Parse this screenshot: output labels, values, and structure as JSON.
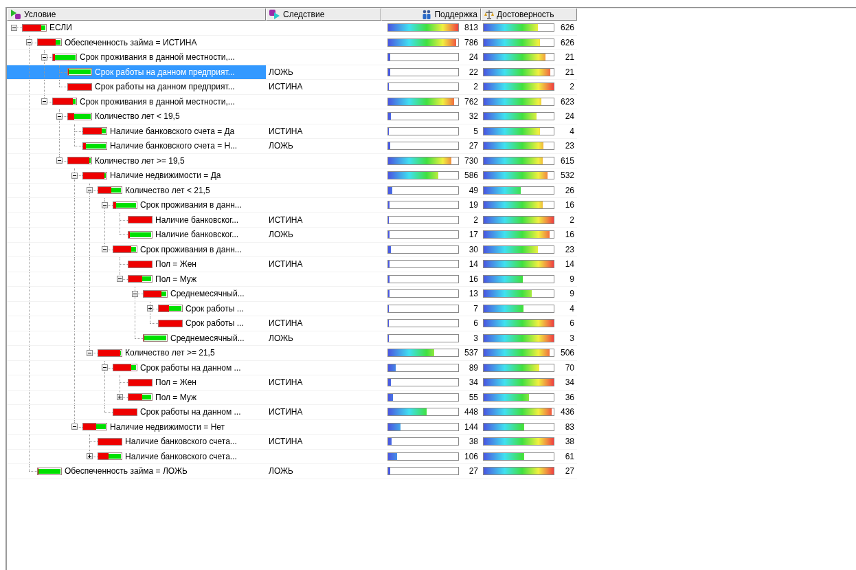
{
  "columns": [
    {
      "label": "Условие"
    },
    {
      "label": "Следствие"
    },
    {
      "label": "Поддержка"
    },
    {
      "label": "Достоверность"
    }
  ],
  "tree": {
    "nodes": [
      {
        "label": "ЕСЛИ",
        "split": {
          "level": 0.8
        },
        "support": {
          "value": "813",
          "level": 1
        },
        "confidence": {
          "value": "626",
          "level": 0.77
        },
        "expanded": true,
        "selected": false,
        "children": [
          {
            "label": "Обеспеченность займа = ИСТИНА",
            "split": {
              "level": 0.75
            },
            "support": {
              "value": "786",
              "level": 0.97
            },
            "confidence": {
              "value": "626",
              "level": 0.8
            },
            "expanded": true,
            "selected": false,
            "children": [
              {
                "label": "Срок проживания в данной местности,...",
                "split": {
                  "level": 0.1
                },
                "support": {
                  "value": "24",
                  "level": 0.03
                },
                "confidence": {
                  "value": "21",
                  "level": 0.88
                },
                "expanded": true,
                "selected": false,
                "children": [
                  {
                    "label": "Срок работы на данном предприят...",
                    "result": "ЛОЖЬ",
                    "split": {
                      "level": 0.03
                    },
                    "support": {
                      "value": "22",
                      "level": 0.03
                    },
                    "confidence": {
                      "value": "21",
                      "level": 0.95
                    },
                    "selected": true
                  },
                  {
                    "label": "Срок работы на данном предприят...",
                    "result": "ИСТИНА",
                    "split": {
                      "level": 1
                    },
                    "support": {
                      "value": "2",
                      "level": 0
                    },
                    "confidence": {
                      "value": "2",
                      "level": 1
                    },
                    "selected": false
                  }
                ]
              },
              {
                "label": "Срок проживания в данной местности,...",
                "split": {
                  "level": 0.85
                },
                "support": {
                  "value": "762",
                  "level": 0.94
                },
                "confidence": {
                  "value": "623",
                  "level": 0.82
                },
                "expanded": true,
                "selected": false,
                "children": [
                  {
                    "label": "Количество лет < 19,5",
                    "split": {
                      "level": 0.25
                    },
                    "support": {
                      "value": "32",
                      "level": 0.04
                    },
                    "confidence": {
                      "value": "24",
                      "level": 0.75
                    },
                    "expanded": true,
                    "selected": false,
                    "children": [
                      {
                        "label": "Наличие банковского счета = Да",
                        "result": "ИСТИНА",
                        "split": {
                          "level": 0.8
                        },
                        "support": {
                          "value": "5",
                          "level": 0.01
                        },
                        "confidence": {
                          "value": "4",
                          "level": 0.8
                        },
                        "selected": false
                      },
                      {
                        "label": "Наличие банковского счета = Н...",
                        "result": "ЛОЖЬ",
                        "split": {
                          "level": 0.12
                        },
                        "support": {
                          "value": "27",
                          "level": 0.03
                        },
                        "confidence": {
                          "value": "23",
                          "level": 0.85
                        },
                        "selected": false
                      }
                    ]
                  },
                  {
                    "label": "Количество лет >= 19,5",
                    "split": {
                      "level": 0.9
                    },
                    "support": {
                      "value": "730",
                      "level": 0.9
                    },
                    "confidence": {
                      "value": "615",
                      "level": 0.84
                    },
                    "expanded": true,
                    "selected": false,
                    "children": [
                      {
                        "label": "Наличие недвижимости = Да",
                        "split": {
                          "level": 0.92
                        },
                        "support": {
                          "value": "586",
                          "level": 0.72
                        },
                        "confidence": {
                          "value": "532",
                          "level": 0.91
                        },
                        "expanded": true,
                        "selected": false,
                        "children": [
                          {
                            "label": "Количество лет < 21,5",
                            "split": {
                              "level": 0.55
                            },
                            "support": {
                              "value": "49",
                              "level": 0.06
                            },
                            "confidence": {
                              "value": "26",
                              "level": 0.53
                            },
                            "expanded": true,
                            "selected": false,
                            "children": [
                              {
                                "label": "Срок проживания в данн...",
                                "split": {
                                  "level": 0.12
                                },
                                "support": {
                                  "value": "19",
                                  "level": 0.02
                                },
                                "confidence": {
                                  "value": "16",
                                  "level": 0.84
                                },
                                "expanded": true,
                                "selected": false,
                                "children": [
                                  {
                                    "label": "Наличие банковског...",
                                    "result": "ИСТИНА",
                                    "split": {
                                      "level": 1
                                    },
                                    "support": {
                                      "value": "2",
                                      "level": 0
                                    },
                                    "confidence": {
                                      "value": "2",
                                      "level": 1
                                    },
                                    "selected": false
                                  },
                                  {
                                    "label": "Наличие банковског...",
                                    "result": "ЛОЖЬ",
                                    "split": {
                                      "level": 0.06
                                    },
                                    "support": {
                                      "value": "17",
                                      "level": 0.02
                                    },
                                    "confidence": {
                                      "value": "16",
                                      "level": 0.94
                                    },
                                    "selected": false
                                  }
                                ]
                              },
                              {
                                "label": "Срок проживания в данн...",
                                "split": {
                                  "level": 0.75
                                },
                                "support": {
                                  "value": "30",
                                  "level": 0.04
                                },
                                "confidence": {
                                  "value": "23",
                                  "level": 0.77
                                },
                                "expanded": true,
                                "selected": false,
                                "children": [
                                  {
                                    "label": "Пол = Жен",
                                    "result": "ИСТИНА",
                                    "split": {
                                      "level": 1
                                    },
                                    "support": {
                                      "value": "14",
                                      "level": 0.02
                                    },
                                    "confidence": {
                                      "value": "14",
                                      "level": 1
                                    },
                                    "selected": false
                                  },
                                  {
                                    "label": "Пол = Муж",
                                    "split": {
                                      "level": 0.6
                                    },
                                    "support": {
                                      "value": "16",
                                      "level": 0.02
                                    },
                                    "confidence": {
                                      "value": "9",
                                      "level": 0.56
                                    },
                                    "expanded": true,
                                    "selected": false,
                                    "children": [
                                      {
                                        "label": "Среднемесячный...",
                                        "split": {
                                          "level": 0.75
                                        },
                                        "support": {
                                          "value": "13",
                                          "level": 0.02
                                        },
                                        "confidence": {
                                          "value": "9",
                                          "level": 0.69
                                        },
                                        "expanded": true,
                                        "selected": false,
                                        "children": [
                                          {
                                            "label": "Срок работы ...",
                                            "split": {
                                              "level": 0.45
                                            },
                                            "support": {
                                              "value": "7",
                                              "level": 0.01
                                            },
                                            "confidence": {
                                              "value": "4",
                                              "level": 0.57
                                            },
                                            "expanded": false,
                                            "selected": false
                                          },
                                          {
                                            "label": "Срок работы ...",
                                            "result": "ИСТИНА",
                                            "split": {
                                              "level": 1
                                            },
                                            "support": {
                                              "value": "6",
                                              "level": 0.01
                                            },
                                            "confidence": {
                                              "value": "6",
                                              "level": 1
                                            },
                                            "selected": false
                                          }
                                        ]
                                      },
                                      {
                                        "label": "Среднемесячный...",
                                        "result": "ЛОЖЬ",
                                        "split": {
                                          "level": 0
                                        },
                                        "support": {
                                          "value": "3",
                                          "level": 0
                                        },
                                        "confidence": {
                                          "value": "3",
                                          "level": 1
                                        },
                                        "selected": false
                                      }
                                    ]
                                  }
                                ]
                              }
                            ]
                          },
                          {
                            "label": "Количество лет >= 21,5",
                            "split": {
                              "level": 0.95
                            },
                            "support": {
                              "value": "537",
                              "level": 0.66
                            },
                            "confidence": {
                              "value": "506",
                              "level": 0.94
                            },
                            "expanded": true,
                            "selected": false,
                            "children": [
                              {
                                "label": "Срок работы на данном ...",
                                "split": {
                                  "level": 0.75
                                },
                                "support": {
                                  "value": "89",
                                  "level": 0.11
                                },
                                "confidence": {
                                  "value": "70",
                                  "level": 0.79
                                },
                                "expanded": true,
                                "selected": false,
                                "children": [
                                  {
                                    "label": "Пол = Жен",
                                    "result": "ИСТИНА",
                                    "split": {
                                      "level": 1
                                    },
                                    "support": {
                                      "value": "34",
                                      "level": 0.04
                                    },
                                    "confidence": {
                                      "value": "34",
                                      "level": 1
                                    },
                                    "selected": false
                                  },
                                  {
                                    "label": "Пол = Муж",
                                    "split": {
                                      "level": 0.6
                                    },
                                    "support": {
                                      "value": "55",
                                      "level": 0.07
                                    },
                                    "confidence": {
                                      "value": "36",
                                      "level": 0.65
                                    },
                                    "expanded": false,
                                    "selected": false
                                  }
                                ]
                              },
                              {
                                "label": "Срок работы на данном ...",
                                "result": "ИСТИНА",
                                "split": {
                                  "level": 1
                                },
                                "support": {
                                  "value": "448",
                                  "level": 0.55
                                },
                                "confidence": {
                                  "value": "436",
                                  "level": 0.97
                                },
                                "selected": false
                              }
                            ]
                          }
                        ]
                      },
                      {
                        "label": "Наличие недвижимости = Нет",
                        "split": {
                          "level": 0.55
                        },
                        "support": {
                          "value": "144",
                          "level": 0.18
                        },
                        "confidence": {
                          "value": "83",
                          "level": 0.58
                        },
                        "expanded": true,
                        "selected": false,
                        "children": [
                          {
                            "label": "Наличие банковского счета...",
                            "result": "ИСТИНА",
                            "split": {
                              "level": 1
                            },
                            "support": {
                              "value": "38",
                              "level": 0.05
                            },
                            "confidence": {
                              "value": "38",
                              "level": 1
                            },
                            "selected": false
                          },
                          {
                            "label": "Наличие банковского счета...",
                            "split": {
                              "level": 0.45
                            },
                            "support": {
                              "value": "106",
                              "level": 0.13
                            },
                            "confidence": {
                              "value": "61",
                              "level": 0.58
                            },
                            "expanded": false,
                            "selected": false
                          }
                        ]
                      }
                    ]
                  }
                ]
              }
            ]
          },
          {
            "label": "Обеспеченность займа = ЛОЖЬ",
            "result": "ЛОЖЬ",
            "split": {
              "level": 0
            },
            "support": {
              "value": "27",
              "level": 0.03
            },
            "confidence": {
              "value": "27",
              "level": 1
            },
            "selected": false
          }
        ]
      }
    ]
  }
}
